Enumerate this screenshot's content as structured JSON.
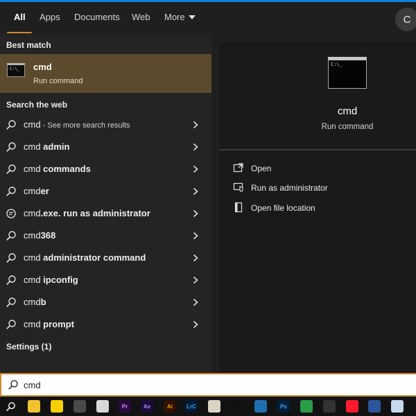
{
  "tabs": [
    {
      "label": "All",
      "active": true
    },
    {
      "label": "Apps"
    },
    {
      "label": "Documents"
    },
    {
      "label": "Web"
    },
    {
      "label": "More"
    }
  ],
  "user_initial": "C",
  "sections": {
    "best_match": "Best match",
    "search_web": "Search the web",
    "settings": "Settings (1)"
  },
  "best_match": {
    "title": "cmd",
    "subtitle": "Run command",
    "icon": "command-prompt-icon"
  },
  "web_results": [
    {
      "prefix": "cmd",
      "suffix": "",
      "hint": " - See more search results",
      "icon": "search-icon"
    },
    {
      "prefix": "cmd ",
      "suffix": "admin",
      "hint": "",
      "icon": "search-icon"
    },
    {
      "prefix": "cmd ",
      "suffix": "commands",
      "hint": "",
      "icon": "search-icon"
    },
    {
      "prefix": "cmd",
      "suffix": "er",
      "hint": "",
      "icon": "search-icon"
    },
    {
      "prefix": "cmd",
      "suffix": ".exe. run as administrator",
      "hint": "",
      "icon": "chat-bubble-icon"
    },
    {
      "prefix": "cmd",
      "suffix": "368",
      "hint": "",
      "icon": "search-icon"
    },
    {
      "prefix": "cmd ",
      "suffix": "administrator command",
      "hint": "",
      "icon": "search-icon"
    },
    {
      "prefix": "cmd ",
      "suffix": "ipconfig",
      "hint": "",
      "icon": "search-icon"
    },
    {
      "prefix": "cmd",
      "suffix": "b",
      "hint": "",
      "icon": "search-icon"
    },
    {
      "prefix": "cmd ",
      "suffix": "prompt",
      "hint": "",
      "icon": "search-icon"
    }
  ],
  "preview": {
    "title": "cmd",
    "subtitle": "Run command",
    "actions": [
      {
        "label": "Open",
        "icon": "open-external-icon"
      },
      {
        "label": "Run as administrator",
        "icon": "shield-admin-icon"
      },
      {
        "label": "Open file location",
        "icon": "folder-location-icon"
      }
    ]
  },
  "search": {
    "value": "cmd"
  },
  "taskbar": [
    {
      "name": "search-icon"
    },
    {
      "name": "file-explorer-icon",
      "color": "#f2c230"
    },
    {
      "name": "sticky-notes-icon",
      "color": "#f7d000"
    },
    {
      "name": "calculator-icon",
      "color": "#4a4a4a"
    },
    {
      "name": "paint-icon",
      "color": "#d8d8d8"
    },
    {
      "name": "premiere-pro-icon",
      "color": "#2a0a3a",
      "text": "Pr",
      "text_color": "#c98bff"
    },
    {
      "name": "after-effects-icon",
      "color": "#1c0a3a",
      "text": "Ae",
      "text_color": "#a08cff"
    },
    {
      "name": "illustrator-icon",
      "color": "#2e1200",
      "text": "Ai",
      "text_color": "#ff9a00"
    },
    {
      "name": "lightroom-classic-icon",
      "color": "#001a33",
      "text": "LrC",
      "text_color": "#31a8ff"
    },
    {
      "name": "media-player-icon",
      "color": "#d9d4c4"
    },
    {
      "name": "tiktok-icon",
      "color": "#111111"
    },
    {
      "name": "vscode-like-icon",
      "color": "#1e6fb0"
    },
    {
      "name": "photoshop-icon",
      "color": "#001e36",
      "text": "Ps",
      "text_color": "#31a8ff"
    },
    {
      "name": "paint-palette-icon",
      "color": "#2a9d48"
    },
    {
      "name": "screen-recorder-icon",
      "color": "#333333"
    },
    {
      "name": "opera-icon",
      "color": "#ff1b2d"
    },
    {
      "name": "word-icon",
      "color": "#2b579a"
    },
    {
      "name": "notepad-icon",
      "color": "#c6d9ef"
    }
  ]
}
